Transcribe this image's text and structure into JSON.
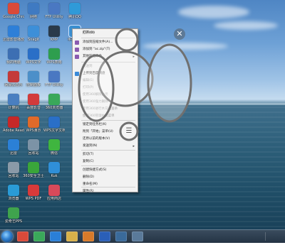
{
  "desktop": {
    "icons": [
      {
        "label": "Google Chrome",
        "color": "#d94a3a"
      },
      {
        "label": "迅雷影音播放器",
        "color": "#2e7fd8"
      },
      {
        "label": "我的电脑",
        "color": "#3d6fb3"
      },
      {
        "label": "网易云音乐",
        "color": "#c43a3a"
      },
      {
        "label": "计算机",
        "color": "#4a7fc0"
      },
      {
        "label": "Adobe Reader",
        "color": "#c62828"
      },
      {
        "label": "迅雷",
        "color": "#2b80d6"
      },
      {
        "label": "回收站",
        "color": "#8a9aa8"
      },
      {
        "label": "浏览器",
        "color": "#2a9bd6"
      },
      {
        "label": "爱奇艺PPS",
        "color": "#3fa34d"
      },
      {
        "label": "网络",
        "color": "#3f7ac2"
      },
      {
        "label": "Snagit",
        "color": "#3d8fd8"
      },
      {
        "label": "WPS文字",
        "color": "#2a6fc7"
      },
      {
        "label": "控制面板",
        "color": "#4c8fc9"
      },
      {
        "label": "百度影音",
        "color": "#d23b3b"
      },
      {
        "label": "WPS演示",
        "color": "#e06a2a"
      },
      {
        "label": "回收站",
        "color": "#7c93a6"
      },
      {
        "label": "360安全卫士",
        "color": "#3aa53a"
      },
      {
        "label": "WPS PDF",
        "color": "#d83a3a"
      },
      {
        "label": "FTP Utility",
        "color": "#4a78c2"
      },
      {
        "label": "KMP",
        "color": "#2a3a4a"
      },
      {
        "label": "WPS表格",
        "color": "#2e9e4e"
      },
      {
        "label": "FTP Utility",
        "color": "#4a78c2"
      },
      {
        "label": "360浏览器",
        "color": "#3aa85a"
      },
      {
        "label": "WPS文字文档",
        "color": "#2a6fc7"
      },
      {
        "label": "微信",
        "color": "#3fb53f"
      },
      {
        "label": "Kuk",
        "color": "#2f8fd8"
      },
      {
        "label": "应用商店",
        "color": "#d84a5a"
      },
      {
        "label": "腾讯QQ",
        "color": "#2f9ad8"
      },
      {
        "label": "手机助手",
        "color": "#3a8fd0"
      }
    ]
  },
  "menu": {
    "items": [
      {
        "label": "打开(O)",
        "bold": true,
        "icon_color": "",
        "disabled": false,
        "arrow": ""
      },
      {
        "label": "添加到压缩文件(A)...",
        "bold": false,
        "icon_color": "#8a5ab0",
        "disabled": false,
        "arrow": ""
      },
      {
        "label": "添加到 \"ac.zip\"(T)",
        "bold": false,
        "icon_color": "#8a5ab0",
        "disabled": false,
        "arrow": ""
      },
      {
        "label": "其他压缩命令",
        "bold": false,
        "icon_color": "#8a5ab0",
        "disabled": false,
        "arrow": "▸"
      },
      {
        "label": "发送到",
        "bold": false,
        "icon_color": "",
        "disabled": true,
        "arrow": ""
      },
      {
        "label": "上传到百度网盘",
        "bold": false,
        "icon_color": "#3a8ad8",
        "disabled": false,
        "arrow": ""
      },
      {
        "label": "编辑(E)",
        "bold": false,
        "icon_color": "",
        "disabled": true,
        "arrow": ""
      },
      {
        "label": "打印(P)",
        "bold": false,
        "icon_color": "",
        "disabled": true,
        "arrow": ""
      },
      {
        "label": "使用360解除占用",
        "bold": false,
        "icon_color": "",
        "disabled": true,
        "arrow": ""
      },
      {
        "label": "使用360强力删除",
        "bold": false,
        "icon_color": "",
        "disabled": true,
        "arrow": ""
      },
      {
        "label": "使用360进行木马云查杀",
        "bold": false,
        "icon_color": "",
        "disabled": true,
        "arrow": ""
      },
      {
        "label": "使用360管理右键菜单",
        "bold": false,
        "icon_color": "",
        "disabled": true,
        "arrow": ""
      },
      {
        "label": "锁定到任务栏(K)",
        "bold": false,
        "icon_color": "",
        "disabled": false,
        "arrow": ""
      },
      {
        "label": "附到「开始」菜单(U)",
        "bold": false,
        "icon_color": "",
        "disabled": false,
        "arrow": ""
      },
      {
        "label": "还原以前的版本(V)",
        "bold": false,
        "icon_color": "",
        "disabled": false,
        "arrow": ""
      },
      {
        "label": "发送到(N)",
        "bold": false,
        "icon_color": "",
        "disabled": false,
        "arrow": "▸"
      },
      {
        "label": "剪切(T)",
        "bold": false,
        "icon_color": "",
        "disabled": false,
        "arrow": ""
      },
      {
        "label": "复制(C)",
        "bold": false,
        "icon_color": "",
        "disabled": false,
        "arrow": ""
      },
      {
        "label": "创建快捷方式(S)",
        "bold": false,
        "icon_color": "",
        "disabled": false,
        "arrow": ""
      },
      {
        "label": "删除(D)",
        "bold": false,
        "icon_color": "",
        "disabled": false,
        "arrow": ""
      },
      {
        "label": "重命名(M)",
        "bold": false,
        "icon_color": "",
        "disabled": false,
        "arrow": ""
      },
      {
        "label": "属性(R)",
        "bold": false,
        "icon_color": "",
        "disabled": false,
        "arrow": ""
      }
    ]
  },
  "overlay": {
    "close_symbol": "✕",
    "grip_symbol": "☰"
  },
  "taskbar": {
    "apps": [
      {
        "name": "chrome-taskbar-icon",
        "color": "#d94a3a"
      },
      {
        "name": "360-browser-taskbar-icon",
        "color": "#3aa85a"
      },
      {
        "name": "ie-taskbar-icon",
        "color": "#2a7fd8"
      },
      {
        "name": "folder-taskbar-icon",
        "color": "#d8b04a"
      },
      {
        "name": "media-taskbar-icon",
        "color": "#d87a2a"
      },
      {
        "name": "word-taskbar-icon",
        "color": "#2a5fb8"
      },
      {
        "name": "app-taskbar-icon",
        "color": "#3a6a9a"
      },
      {
        "name": "app2-taskbar-icon",
        "color": "#5a7a9a"
      }
    ]
  }
}
